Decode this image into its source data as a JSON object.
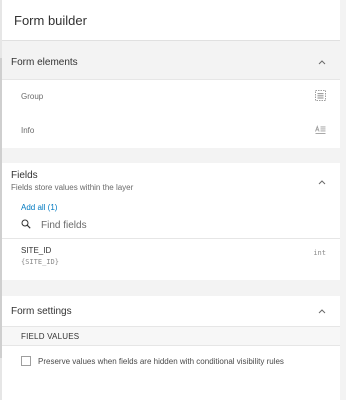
{
  "header": {
    "title": "Form builder"
  },
  "form_elements": {
    "title": "Form elements",
    "items": [
      {
        "label": "Group",
        "icon": "group-icon"
      },
      {
        "label": "Info",
        "icon": "text-info-icon"
      }
    ]
  },
  "fields": {
    "title": "Fields",
    "subtitle": "Fields store values within the layer",
    "add_all": "Add all (1)",
    "search_placeholder": "Find fields",
    "items": [
      {
        "name": "SITE_ID",
        "alias": "{SITE_ID}",
        "type": "int"
      }
    ]
  },
  "form_settings": {
    "title": "Form settings",
    "subheader": "FIELD VALUES",
    "checkbox_label": "Preserve values when fields are hidden with conditional visibility rules",
    "checkbox_checked": false
  },
  "colors": {
    "accent": "#0079c1",
    "section_bg": "#f3f3f3"
  }
}
